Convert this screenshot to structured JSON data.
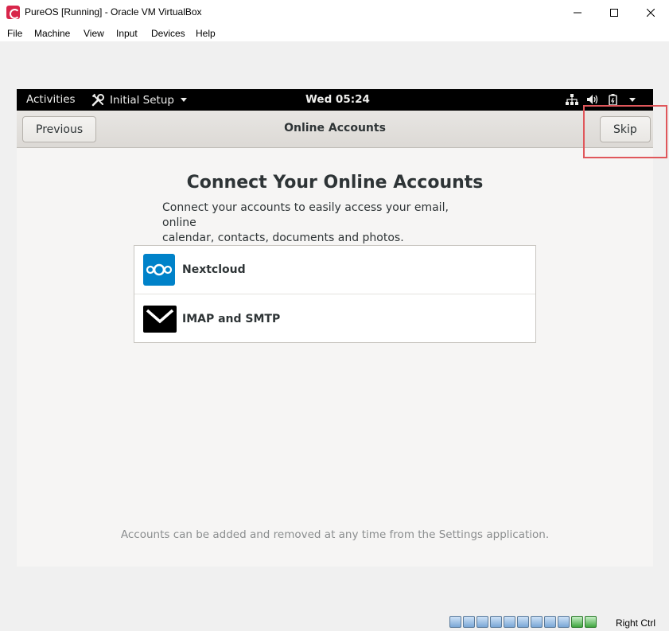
{
  "window": {
    "title": "PureOS [Running] - Oracle VM VirtualBox",
    "controls": [
      "minimize",
      "maximize",
      "close"
    ]
  },
  "menubar": {
    "items": [
      "File",
      "Machine",
      "View",
      "Input",
      "Devices",
      "Help"
    ]
  },
  "gnome_topbar": {
    "activities": "Activities",
    "app_menu": "Initial Setup",
    "clock": "Wed 05:24",
    "tray_icons": [
      "network-icon",
      "volume-icon",
      "battery-icon",
      "system-menu-arrow"
    ]
  },
  "headerbar": {
    "previous_label": "Previous",
    "title": "Online Accounts",
    "skip_label": "Skip"
  },
  "content": {
    "heading": "Connect Your Online Accounts",
    "description_line1": "Connect your accounts to easily access your email, online",
    "description_line2": "calendar, contacts, documents and photos.",
    "providers": [
      {
        "label": "Nextcloud",
        "icon": "nextcloud-icon"
      },
      {
        "label": "IMAP and SMTP",
        "icon": "mail-envelope-icon"
      }
    ],
    "footer_note": "Accounts can be added and removed at any time from the Settings application."
  },
  "statusbar": {
    "host_key": "Right Ctrl"
  },
  "colors": {
    "highlight": "#e0575b",
    "nextcloud_blue": "#0082c9",
    "gnome_topbar": "#000000"
  }
}
